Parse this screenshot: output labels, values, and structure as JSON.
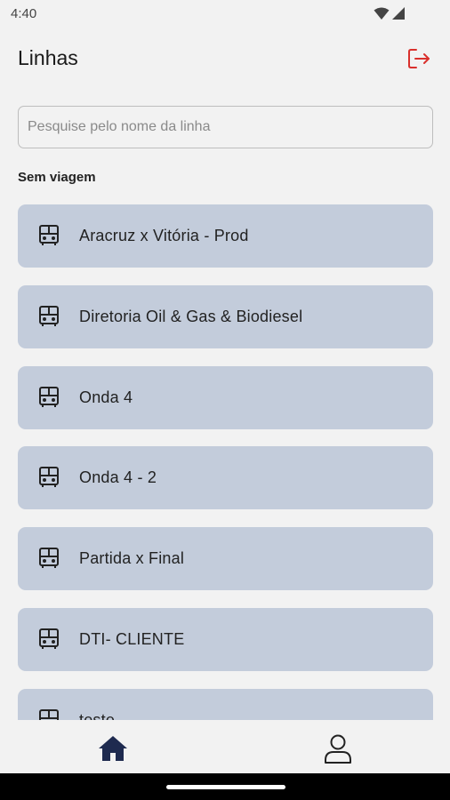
{
  "status_bar": {
    "time": "4:40"
  },
  "header": {
    "title": "Linhas"
  },
  "search": {
    "placeholder": "Pesquise pelo nome da linha",
    "value": ""
  },
  "section": {
    "label": "Sem viagem"
  },
  "lines": [
    {
      "name": "Aracruz x Vitória - Prod"
    },
    {
      "name": "Diretoria Oil & Gas & Biodiesel"
    },
    {
      "name": "Onda 4"
    },
    {
      "name": "Onda 4 - 2"
    },
    {
      "name": "Partida x Final"
    },
    {
      "name": "DTI- CLIENTE"
    },
    {
      "name": "teste"
    }
  ],
  "icons": {
    "logout": "logout-icon",
    "line": "bus-icon",
    "home": "home-icon",
    "profile": "profile-icon"
  },
  "colors": {
    "background": "#f2f2f2",
    "card": "#c3ccdb",
    "accent": "#1e2a4f",
    "logout": "#d9302c"
  }
}
